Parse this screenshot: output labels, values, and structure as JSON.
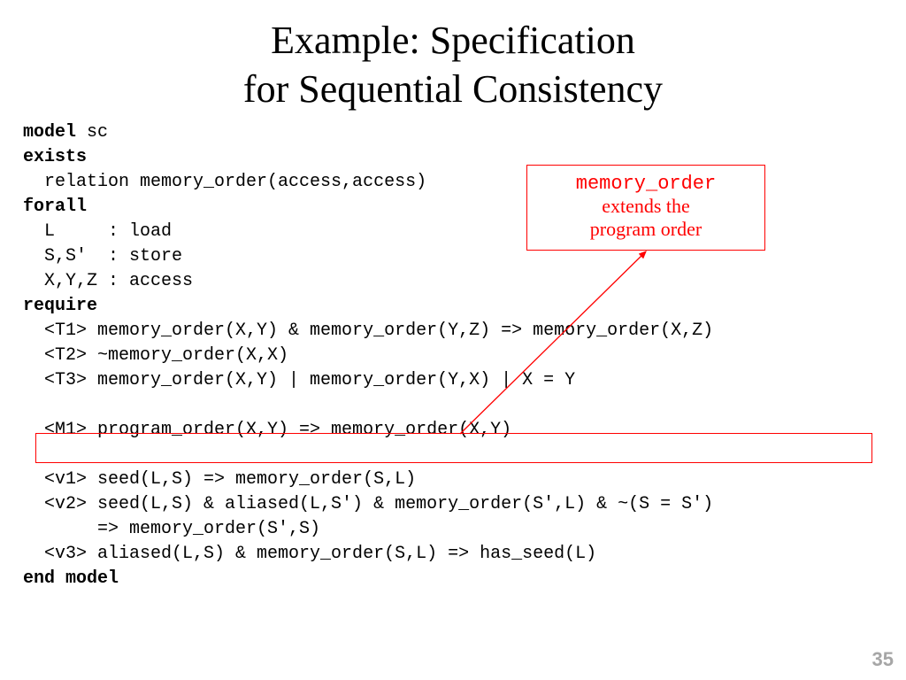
{
  "title_line1": "Example: Specification",
  "title_line2": "for Sequential Consistency",
  "code": {
    "kw_model": "model",
    "model_name": " sc",
    "kw_exists": "exists",
    "exists_body": "  relation memory_order(access,access)",
    "kw_forall": "forall",
    "forall_1": "  L     : load",
    "forall_2": "  S,S'  : store",
    "forall_3": "  X,Y,Z : access",
    "kw_require": "require",
    "t1": "  <T1> memory_order(X,Y) & memory_order(Y,Z) => memory_order(X,Z)",
    "t2": "  <T2> ~memory_order(X,X)",
    "t3": "  <T3> memory_order(X,Y) | memory_order(Y,X) | X = Y",
    "blank1": " ",
    "m1": "  <M1> program_order(X,Y) => memory_order(X,Y)",
    "blank2": " ",
    "v1": "  <v1> seed(L,S) => memory_order(S,L)",
    "v2a": "  <v2> seed(L,S) & aliased(L,S') & memory_order(S',L) & ~(S = S')",
    "v2b": "       => memory_order(S',S)",
    "v3": "  <v3> aliased(L,S) & memory_order(S,L) => has_seed(L)",
    "kw_end": "end model"
  },
  "callout": {
    "mono": "memory_order",
    "line2": "extends the",
    "line3": "program order"
  },
  "page_number": "35"
}
